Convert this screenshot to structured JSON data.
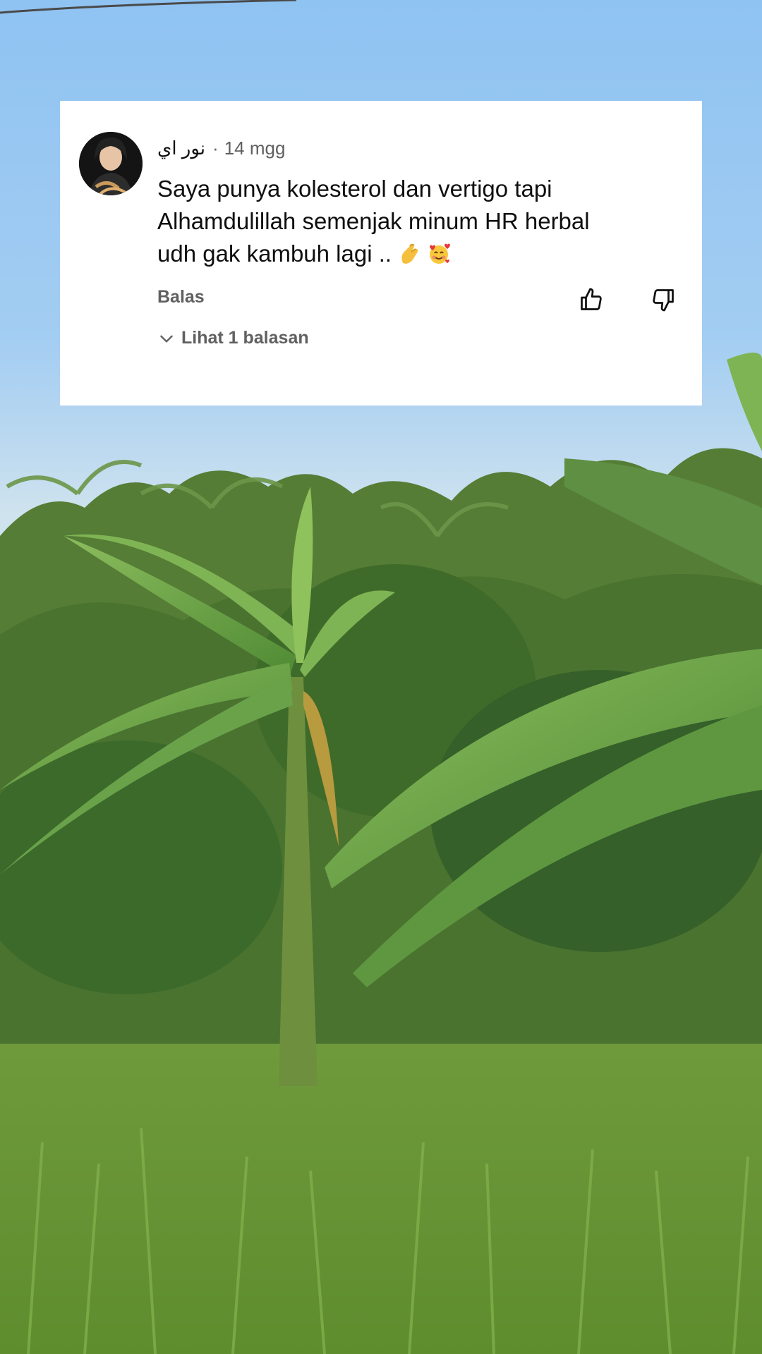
{
  "comment": {
    "author": "نور اي",
    "separator": "·",
    "timestamp": "14 mgg",
    "text_lines": [
      "Saya punya kolesterol dan vertigo tapi",
      "Alhamdulillah semenjak minum HR herbal",
      "udh gak kambuh lagi .."
    ],
    "emojis": [
      "pinched-fingers-emoji",
      "smiling-face-with-hearts-emoji"
    ],
    "reply_label": "Balas",
    "view_replies_label": "Lihat 1 balasan"
  },
  "colors": {
    "sky": "#a3cdf2",
    "card_background": "#ffffff",
    "primary_text": "#0f0f0f",
    "secondary_text": "#606060",
    "foliage_dark": "#3f6b2a",
    "foliage_light": "#8fbf5a"
  },
  "icons": {
    "like": "thumbs-up-icon",
    "dislike": "thumbs-down-icon",
    "expand": "chevron-down-icon"
  }
}
